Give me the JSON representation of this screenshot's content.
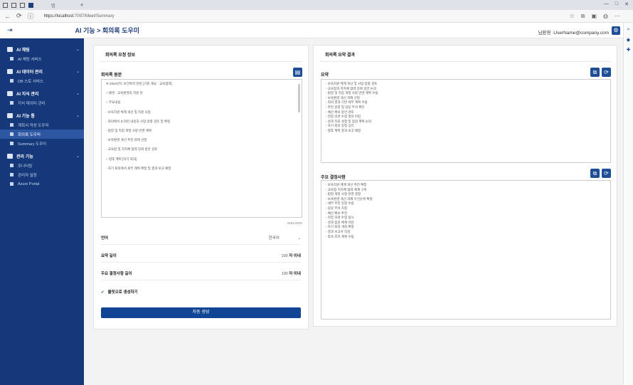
{
  "browser": {
    "tab_label": "탭",
    "url_host": "https://localhost",
    "url_path": ":7097/Meet/Summary"
  },
  "header": {
    "title": "AI 기능 > 회의록 도우미",
    "user": "님환영 ·UserName@company.com"
  },
  "sidebar": {
    "groups": [
      {
        "label": "AI 채팅",
        "items": [
          {
            "label": "AI 채팅 서비스"
          }
        ]
      },
      {
        "label": "AI 데이터 관리",
        "items": [
          {
            "label": "DB 스토 서비스"
          }
        ]
      },
      {
        "label": "AI 지식 관리",
        "items": [
          {
            "label": "지식 데이터 관리"
          }
        ]
      },
      {
        "label": "AI 기능 통",
        "items": [
          {
            "label": "계획서 작성 도우미"
          },
          {
            "label": "회의록 도우미"
          },
          {
            "label": "Summary 도우미"
          }
        ]
      },
      {
        "label": "관리 기능",
        "items": [
          {
            "label": "모니터링"
          },
          {
            "label": "관리자 설정"
          },
          {
            "label": "Azure Portal"
          }
        ]
      }
    ]
  },
  "left": {
    "title": "회의록 요청 정보",
    "content_label": "회의록 원문",
    "lines": [
      "※ 2024년도 보건복지 관련 [기준 개요 · 교육협력]",
      "",
      "○ 배경 : 교육환경의 지원 현",
      "",
      "○ 주요내용",
      "",
      "  - 보육지원 체계 개선 및 지원 사업",
      "",
      "  - 회의에서 논의된 내용과 사업 방향 검토 및 확정",
      "",
      "  - 법령 및 지침 개정 사항 반영 계획",
      "",
      "  - 보육환경 개선 추진 과제 선정",
      "",
      "  - 교육청 및 지자체 협력 강화 방안 검토",
      "",
      "○ 향후 계획 [차기 회의]",
      "",
      "  - 차기 회의에서 세부 계획 확정 및 결과 보고 예정"
    ],
    "char_count": "2591/4000",
    "settings": [
      {
        "label": "언어",
        "value": "한국어",
        "unit": ""
      },
      {
        "label": "요약 길이",
        "value": "100",
        "unit": "자 이내"
      },
      {
        "label": "주요 결정사항 길이",
        "value": "100",
        "unit": "자 이내"
      }
    ],
    "checkbox_label": "불릿으로 생성하기",
    "generate_label": "자동 생성"
  },
  "right": {
    "title": "회의록 요약 결과",
    "summary_label": "요약",
    "summary_lines": [
      "- 보육지원 체계 개선 및 사업 방향 검토",
      "- 교육청과 지자체 협력 강화 방안 논의",
      "- 법령 및 지침 개정 사항 반영 계획 수립",
      "- 보육환경 개선 과제 선정",
      "- 회의 결과 기반 세부 계획 수립",
      "- 추진 일정 및 담당 부서 확인",
      "- 예산 확보 방안 검토",
      "- 현장 의견 수렴 절차 마련",
      "- 성과 지표 설정 및 점검 계획 논의",
      "- 차기 회의 일정 공유",
      "- 향후 계획 결과 보고 예정"
    ],
    "decisions_label": "주요 결정사항",
    "decision_lines": [
      "- 보육지원 체계 개선 추진 확정",
      "- 교육청·지자체 협력 체계 구축",
      "- 법령 개정 사항 반영 결정",
      "- 보육환경 개선 과제 우선순위 확정",
      "- 세부 추진 일정 수립",
      "- 담당 부서 지정",
      "- 예산 확보 추진",
      "- 현장 의견 수렴 실시",
      "- 성과 점검 체계 마련",
      "- 차기 회의 개최 확정",
      "- 결과 보고서 작성",
      "- 후속 조치 계획 수립"
    ]
  }
}
